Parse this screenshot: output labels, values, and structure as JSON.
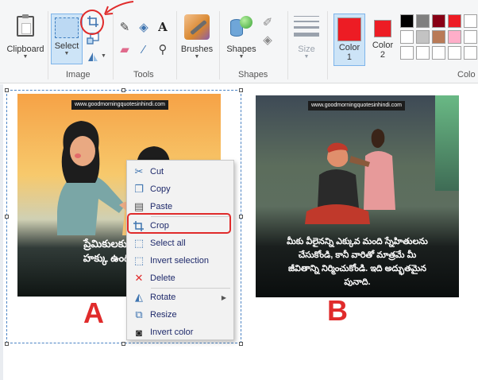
{
  "ribbon": {
    "clipboard": {
      "label": "Clipboard"
    },
    "image": {
      "group_label": "Image",
      "select_label": "Select"
    },
    "tools": {
      "group_label": "Tools"
    },
    "brushes": {
      "label": "Brushes"
    },
    "shapes": {
      "label": "Shapes",
      "group_label": "Shapes"
    },
    "size": {
      "label": "Size"
    },
    "color1": {
      "label_line1": "Color",
      "label_line2": "1",
      "value": "#ed1c24"
    },
    "color2": {
      "label_line1": "Color",
      "label_line2": "2",
      "value": "#ed1c24"
    },
    "colors_group_label": "Colo",
    "palette": [
      "#000000",
      "#7f7f7f",
      "#880015",
      "#ed1c24",
      "#ffffff",
      "#ffffff",
      "#c3c3c3",
      "#b97a57",
      "#ffaec9",
      "#ffffff",
      "#ffffff",
      "#ffffff",
      "#ffffff",
      "#ffffff",
      "#ffffff"
    ]
  },
  "canvas": {
    "image_a": {
      "url": "www.goodmorningquotesinhindi.com",
      "quote_line1": "ప్రేమికులకు మీకు",
      "quote_line2": "హక్కు ఉంది...స్నే"
    },
    "image_b": {
      "url": "www.goodmorningquotesinhindi.com",
      "quote_line1": "మీకు వీలైనన్ని ఎక్కువ మంది స్నేహితులను",
      "quote_line2": "చేసుకోండి, కానీ వారితో మాత్రమే మీ",
      "quote_line3": "జీవితాన్ని నిర్మించుకోండి. ఇది అద్భుతమైన",
      "quote_line4": "పునాది."
    },
    "label_a": "A",
    "label_b": "B"
  },
  "context_menu": {
    "cut": "Cut",
    "copy": "Copy",
    "paste": "Paste",
    "crop": "Crop",
    "select_all": "Select all",
    "invert_selection": "Invert selection",
    "delete": "Delete",
    "rotate": "Rotate",
    "resize": "Resize",
    "invert_color": "Invert color"
  },
  "colors": {
    "accent": "#e02b2b",
    "selection": "#cde4f7"
  }
}
